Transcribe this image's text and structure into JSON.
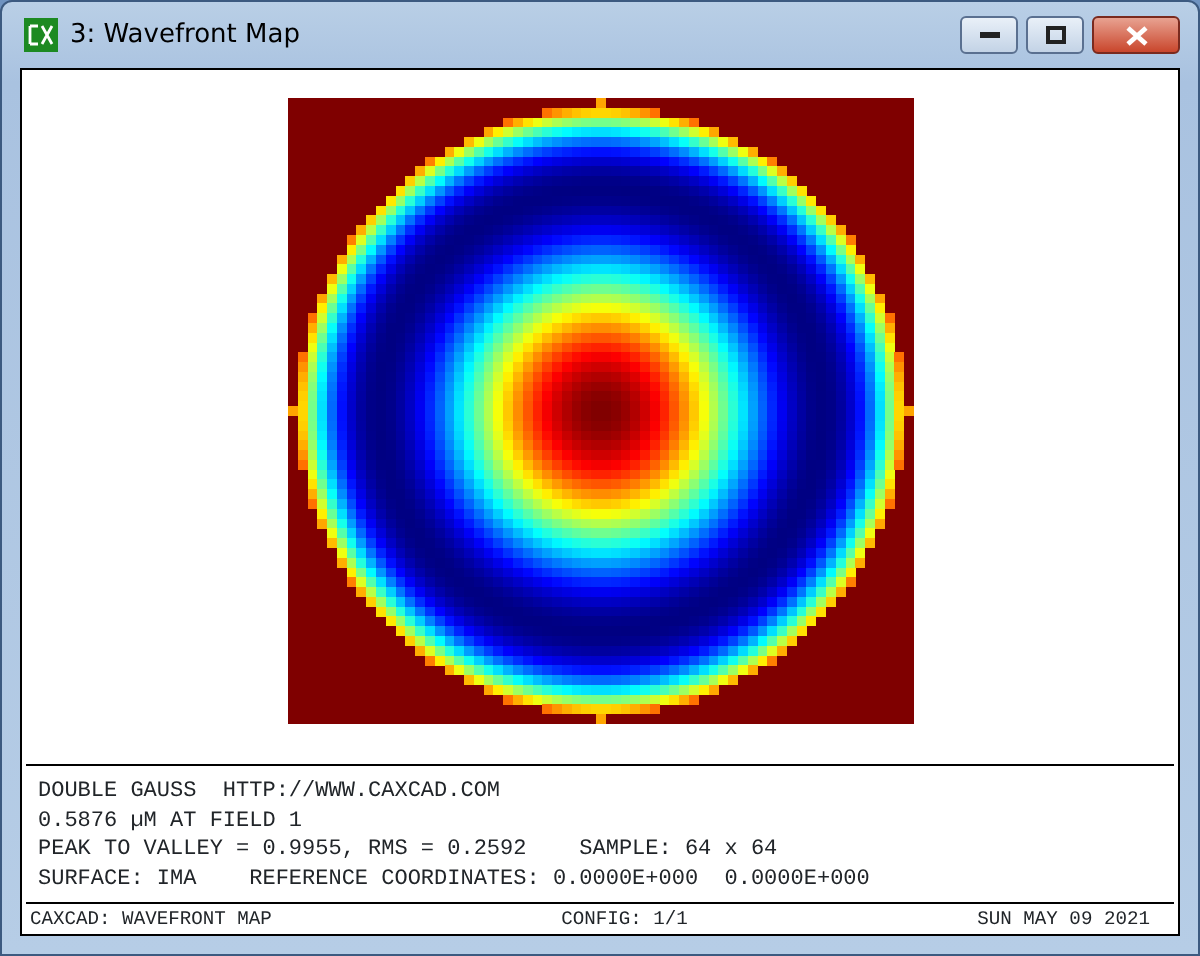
{
  "window": {
    "title": "3: Wavefront Map"
  },
  "info_lines": [
    "DOUBLE GAUSS  HTTP://WWW.CAXCAD.COM",
    "0.5876 µM AT FIELD 1",
    "PEAK TO VALLEY = 0.9955, RMS = 0.2592    SAMPLE: 64 x 64",
    "SURFACE: IMA    REFERENCE COORDINATES: 0.0000E+000  0.0000E+000"
  ],
  "footer": {
    "left": "CAXCAD: WAVEFRONT MAP",
    "center": "CONFIG: 1/1",
    "right": "SUN MAY 09 2021"
  }
}
